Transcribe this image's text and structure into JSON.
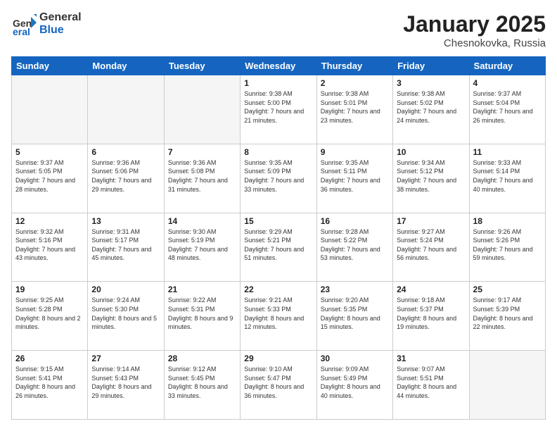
{
  "header": {
    "logo_general": "General",
    "logo_blue": "Blue",
    "month_title": "January 2025",
    "location": "Chesnokovka, Russia"
  },
  "weekdays": [
    "Sunday",
    "Monday",
    "Tuesday",
    "Wednesday",
    "Thursday",
    "Friday",
    "Saturday"
  ],
  "weeks": [
    [
      {
        "day": "",
        "sunrise": "",
        "sunset": "",
        "daylight": "",
        "empty": true
      },
      {
        "day": "",
        "sunrise": "",
        "sunset": "",
        "daylight": "",
        "empty": true
      },
      {
        "day": "",
        "sunrise": "",
        "sunset": "",
        "daylight": "",
        "empty": true
      },
      {
        "day": "1",
        "sunrise": "Sunrise: 9:38 AM",
        "sunset": "Sunset: 5:00 PM",
        "daylight": "Daylight: 7 hours and 21 minutes.",
        "empty": false
      },
      {
        "day": "2",
        "sunrise": "Sunrise: 9:38 AM",
        "sunset": "Sunset: 5:01 PM",
        "daylight": "Daylight: 7 hours and 23 minutes.",
        "empty": false
      },
      {
        "day": "3",
        "sunrise": "Sunrise: 9:38 AM",
        "sunset": "Sunset: 5:02 PM",
        "daylight": "Daylight: 7 hours and 24 minutes.",
        "empty": false
      },
      {
        "day": "4",
        "sunrise": "Sunrise: 9:37 AM",
        "sunset": "Sunset: 5:04 PM",
        "daylight": "Daylight: 7 hours and 26 minutes.",
        "empty": false
      }
    ],
    [
      {
        "day": "5",
        "sunrise": "Sunrise: 9:37 AM",
        "sunset": "Sunset: 5:05 PM",
        "daylight": "Daylight: 7 hours and 28 minutes.",
        "empty": false
      },
      {
        "day": "6",
        "sunrise": "Sunrise: 9:36 AM",
        "sunset": "Sunset: 5:06 PM",
        "daylight": "Daylight: 7 hours and 29 minutes.",
        "empty": false
      },
      {
        "day": "7",
        "sunrise": "Sunrise: 9:36 AM",
        "sunset": "Sunset: 5:08 PM",
        "daylight": "Daylight: 7 hours and 31 minutes.",
        "empty": false
      },
      {
        "day": "8",
        "sunrise": "Sunrise: 9:35 AM",
        "sunset": "Sunset: 5:09 PM",
        "daylight": "Daylight: 7 hours and 33 minutes.",
        "empty": false
      },
      {
        "day": "9",
        "sunrise": "Sunrise: 9:35 AM",
        "sunset": "Sunset: 5:11 PM",
        "daylight": "Daylight: 7 hours and 36 minutes.",
        "empty": false
      },
      {
        "day": "10",
        "sunrise": "Sunrise: 9:34 AM",
        "sunset": "Sunset: 5:12 PM",
        "daylight": "Daylight: 7 hours and 38 minutes.",
        "empty": false
      },
      {
        "day": "11",
        "sunrise": "Sunrise: 9:33 AM",
        "sunset": "Sunset: 5:14 PM",
        "daylight": "Daylight: 7 hours and 40 minutes.",
        "empty": false
      }
    ],
    [
      {
        "day": "12",
        "sunrise": "Sunrise: 9:32 AM",
        "sunset": "Sunset: 5:16 PM",
        "daylight": "Daylight: 7 hours and 43 minutes.",
        "empty": false
      },
      {
        "day": "13",
        "sunrise": "Sunrise: 9:31 AM",
        "sunset": "Sunset: 5:17 PM",
        "daylight": "Daylight: 7 hours and 45 minutes.",
        "empty": false
      },
      {
        "day": "14",
        "sunrise": "Sunrise: 9:30 AM",
        "sunset": "Sunset: 5:19 PM",
        "daylight": "Daylight: 7 hours and 48 minutes.",
        "empty": false
      },
      {
        "day": "15",
        "sunrise": "Sunrise: 9:29 AM",
        "sunset": "Sunset: 5:21 PM",
        "daylight": "Daylight: 7 hours and 51 minutes.",
        "empty": false
      },
      {
        "day": "16",
        "sunrise": "Sunrise: 9:28 AM",
        "sunset": "Sunset: 5:22 PM",
        "daylight": "Daylight: 7 hours and 53 minutes.",
        "empty": false
      },
      {
        "day": "17",
        "sunrise": "Sunrise: 9:27 AM",
        "sunset": "Sunset: 5:24 PM",
        "daylight": "Daylight: 7 hours and 56 minutes.",
        "empty": false
      },
      {
        "day": "18",
        "sunrise": "Sunrise: 9:26 AM",
        "sunset": "Sunset: 5:26 PM",
        "daylight": "Daylight: 7 hours and 59 minutes.",
        "empty": false
      }
    ],
    [
      {
        "day": "19",
        "sunrise": "Sunrise: 9:25 AM",
        "sunset": "Sunset: 5:28 PM",
        "daylight": "Daylight: 8 hours and 2 minutes.",
        "empty": false
      },
      {
        "day": "20",
        "sunrise": "Sunrise: 9:24 AM",
        "sunset": "Sunset: 5:30 PM",
        "daylight": "Daylight: 8 hours and 5 minutes.",
        "empty": false
      },
      {
        "day": "21",
        "sunrise": "Sunrise: 9:22 AM",
        "sunset": "Sunset: 5:31 PM",
        "daylight": "Daylight: 8 hours and 9 minutes.",
        "empty": false
      },
      {
        "day": "22",
        "sunrise": "Sunrise: 9:21 AM",
        "sunset": "Sunset: 5:33 PM",
        "daylight": "Daylight: 8 hours and 12 minutes.",
        "empty": false
      },
      {
        "day": "23",
        "sunrise": "Sunrise: 9:20 AM",
        "sunset": "Sunset: 5:35 PM",
        "daylight": "Daylight: 8 hours and 15 minutes.",
        "empty": false
      },
      {
        "day": "24",
        "sunrise": "Sunrise: 9:18 AM",
        "sunset": "Sunset: 5:37 PM",
        "daylight": "Daylight: 8 hours and 19 minutes.",
        "empty": false
      },
      {
        "day": "25",
        "sunrise": "Sunrise: 9:17 AM",
        "sunset": "Sunset: 5:39 PM",
        "daylight": "Daylight: 8 hours and 22 minutes.",
        "empty": false
      }
    ],
    [
      {
        "day": "26",
        "sunrise": "Sunrise: 9:15 AM",
        "sunset": "Sunset: 5:41 PM",
        "daylight": "Daylight: 8 hours and 26 minutes.",
        "empty": false
      },
      {
        "day": "27",
        "sunrise": "Sunrise: 9:14 AM",
        "sunset": "Sunset: 5:43 PM",
        "daylight": "Daylight: 8 hours and 29 minutes.",
        "empty": false
      },
      {
        "day": "28",
        "sunrise": "Sunrise: 9:12 AM",
        "sunset": "Sunset: 5:45 PM",
        "daylight": "Daylight: 8 hours and 33 minutes.",
        "empty": false
      },
      {
        "day": "29",
        "sunrise": "Sunrise: 9:10 AM",
        "sunset": "Sunset: 5:47 PM",
        "daylight": "Daylight: 8 hours and 36 minutes.",
        "empty": false
      },
      {
        "day": "30",
        "sunrise": "Sunrise: 9:09 AM",
        "sunset": "Sunset: 5:49 PM",
        "daylight": "Daylight: 8 hours and 40 minutes.",
        "empty": false
      },
      {
        "day": "31",
        "sunrise": "Sunrise: 9:07 AM",
        "sunset": "Sunset: 5:51 PM",
        "daylight": "Daylight: 8 hours and 44 minutes.",
        "empty": false
      },
      {
        "day": "",
        "sunrise": "",
        "sunset": "",
        "daylight": "",
        "empty": true
      }
    ]
  ]
}
